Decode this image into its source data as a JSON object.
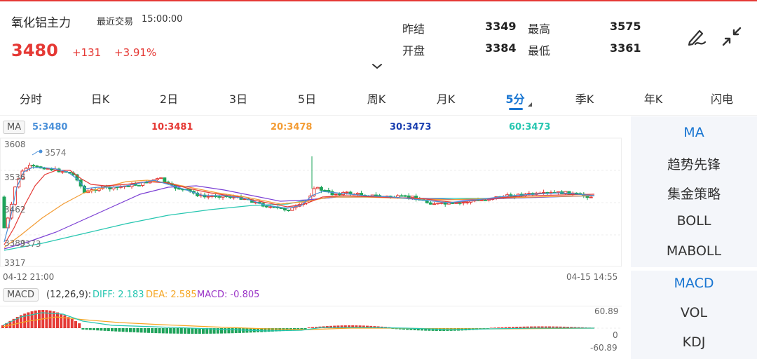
{
  "header": {
    "name": "氧化铝主力",
    "status": "最近交易",
    "time": "15:00:00",
    "price": "3480",
    "change": "+131",
    "change_pct": "+3.91%",
    "quotes": {
      "prev_close_label": "昨结",
      "prev_close": "3349",
      "high_label": "最高",
      "high": "3575",
      "open_label": "开盘",
      "open": "3384",
      "low_label": "最低",
      "low": "3361"
    },
    "icons": [
      "draw-pen-icon",
      "collapse-arrows-icon",
      "chevron-down-icon"
    ]
  },
  "tabs": [
    "分时",
    "日K",
    "2日",
    "3日",
    "5日",
    "周K",
    "月K",
    "5分",
    "季K",
    "年K",
    "闪电"
  ],
  "active_tab": "5分",
  "ma": {
    "tag": "MA",
    "items": [
      {
        "label": "5:3480",
        "color": "#4a90d9"
      },
      {
        "label": "10:3481",
        "color": "#e53935"
      },
      {
        "label": "20:3478",
        "color": "#f39c34"
      },
      {
        "label": "30:3473",
        "color": "#1a3fb0"
      },
      {
        "label": "60:3473",
        "color": "#26c6b0"
      }
    ]
  },
  "main_chart": {
    "y_labels": [
      "3608",
      "3536",
      "3462",
      "3389",
      "3317"
    ],
    "high_mark": "3574",
    "low_mark": "3373",
    "x_start": "04-12 21:00",
    "x_end": "04-15 14:55"
  },
  "macd": {
    "tag": "MACD",
    "params": "(12,26,9):",
    "diff": "DIFF: 2.183",
    "dea": "DEA: 2.585",
    "macd": "MACD: -0.805",
    "y_top": "60.89",
    "y_mid": "0",
    "y_bottom": "-60.89"
  },
  "right_panel": {
    "items": [
      "MA",
      "趋势先锋",
      "集金策略",
      "BOLL",
      "MABOLL",
      "MACD",
      "VOL",
      "KDJ"
    ],
    "active": [
      "MA",
      "MACD"
    ]
  },
  "colors": {
    "up": "#e53935",
    "down": "#1ea35a",
    "accent": "#1976d2",
    "diff": "#26c6b0",
    "dea": "#f5a623",
    "macd": "#9b36c7"
  }
}
